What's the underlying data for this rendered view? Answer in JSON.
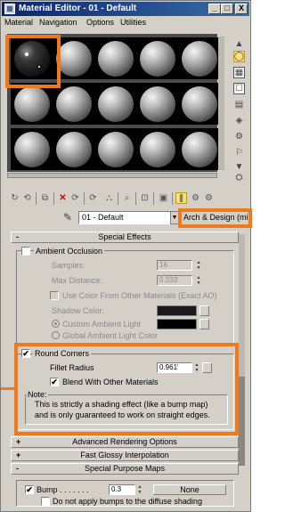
{
  "window": {
    "title": "Material Editor - 01 - Default",
    "minimize": "_",
    "maximize": "□",
    "close": "X"
  },
  "menu": [
    "Material",
    "Navigation",
    "Options",
    "Utilities"
  ],
  "sample_slots": {
    "rows": 3,
    "cols": 5,
    "selected_index": 0
  },
  "material": {
    "name": "01 - Default",
    "type_button": "Arch & Design (mi"
  },
  "special_effects": {
    "header": "Special Effects",
    "sign": "-",
    "ambient_occlusion": {
      "label": "Ambient Occlusion",
      "checked": false,
      "samples_label": "Samples:",
      "samples_value": "16",
      "max_distance_label": "Max Distance:",
      "max_distance_value": "0.333'",
      "use_color_label": "Use Color From Other Materials (Exact AO)",
      "shadow_color_label": "Shadow Color:",
      "custom_ambient_label": "Custom Ambient Light",
      "global_ambient_label": "Global Ambient Light Color"
    },
    "round_corners": {
      "label": "Round Corners",
      "checked": true,
      "fillet_label": "Fillet Radius",
      "fillet_value": "0.961'",
      "blend_label": "Blend With Other Materials",
      "blend_checked": true,
      "note_title": "Note:",
      "note_line1": "This is strictly a shading effect (like a bump map)",
      "note_line2": "and is only guaranteed to work on straight edges."
    }
  },
  "rollouts": [
    {
      "sign": "+",
      "label": "Advanced Rendering Options"
    },
    {
      "sign": "+",
      "label": "Fast Glossy Interpolation"
    },
    {
      "sign": "-",
      "label": "Special Purpose Maps"
    }
  ],
  "special_purpose_maps": {
    "bump_label": "Bump . . . . . . .",
    "bump_checked": true,
    "bump_value": "0.3",
    "bump_map": "None",
    "no_bump_diffuse_label": "Do not apply bumps to the diffuse shading",
    "no_bump_diffuse_checked": false
  },
  "colors": {
    "highlight": "#f07a1b",
    "title_bar": "#0a246a",
    "ui_gray": "#d4d0c8"
  },
  "icons": {
    "checkmark": "✔",
    "spin_up": "▲",
    "spin_down": "▼",
    "dropdown": "▼",
    "sidebar": [
      "▲",
      "◯",
      "▦",
      "☐",
      "▤",
      "◈",
      "⚙",
      "⚐",
      "▼",
      "⛭"
    ],
    "toolbar": [
      "↻",
      "⟲",
      "⧉",
      "✕",
      "⟳",
      "⟳",
      "⛬",
      "⌕",
      "⊡",
      "▣",
      "⫼",
      "⚙",
      "⚙"
    ]
  }
}
